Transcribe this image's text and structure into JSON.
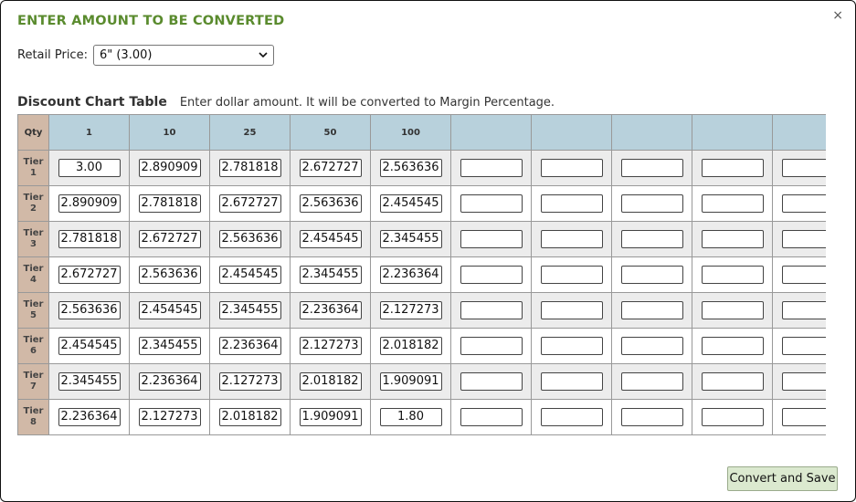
{
  "dialog": {
    "title": "ENTER AMOUNT TO BE CONVERTED",
    "close_icon": "×"
  },
  "retail": {
    "label": "Retail Price:",
    "selected": "6\" (3.00)"
  },
  "table": {
    "title": "Discount Chart Table",
    "subtitle": "Enter dollar amount. It will be converted to Margin Percentage.",
    "qty_header": "Qty",
    "columns": [
      "1",
      "10",
      "25",
      "50",
      "100",
      "",
      "",
      "",
      "",
      ""
    ],
    "rows": [
      {
        "tier": "Tier",
        "num": "1",
        "values": [
          "3.00",
          "2.890909",
          "2.781818",
          "2.672727",
          "2.563636",
          "",
          "",
          "",
          "",
          ""
        ]
      },
      {
        "tier": "Tier",
        "num": "2",
        "values": [
          "2.890909",
          "2.781818",
          "2.672727",
          "2.563636",
          "2.454545",
          "",
          "",
          "",
          "",
          ""
        ]
      },
      {
        "tier": "Tier",
        "num": "3",
        "values": [
          "2.781818",
          "2.672727",
          "2.563636",
          "2.454545",
          "2.345455",
          "",
          "",
          "",
          "",
          ""
        ]
      },
      {
        "tier": "Tier",
        "num": "4",
        "values": [
          "2.672727",
          "2.563636",
          "2.454545",
          "2.345455",
          "2.236364",
          "",
          "",
          "",
          "",
          ""
        ]
      },
      {
        "tier": "Tier",
        "num": "5",
        "values": [
          "2.563636",
          "2.454545",
          "2.345455",
          "2.236364",
          "2.127273",
          "",
          "",
          "",
          "",
          ""
        ]
      },
      {
        "tier": "Tier",
        "num": "6",
        "values": [
          "2.454545",
          "2.345455",
          "2.236364",
          "2.127273",
          "2.018182",
          "",
          "",
          "",
          "",
          ""
        ]
      },
      {
        "tier": "Tier",
        "num": "7",
        "values": [
          "2.345455",
          "2.236364",
          "2.127273",
          "2.018182",
          "1.909091",
          "",
          "",
          "",
          "",
          ""
        ]
      },
      {
        "tier": "Tier",
        "num": "8",
        "values": [
          "2.236364",
          "2.127273",
          "2.018182",
          "1.909091",
          "1.80",
          "",
          "",
          "",
          "",
          ""
        ]
      }
    ]
  },
  "actions": {
    "convert_save": "Convert and Save"
  },
  "colors": {
    "title": "#5a8b2e",
    "header_bg": "#b8d1dc",
    "tier_bg": "#d1b9a7",
    "button_bg": "#dbe9cf"
  }
}
